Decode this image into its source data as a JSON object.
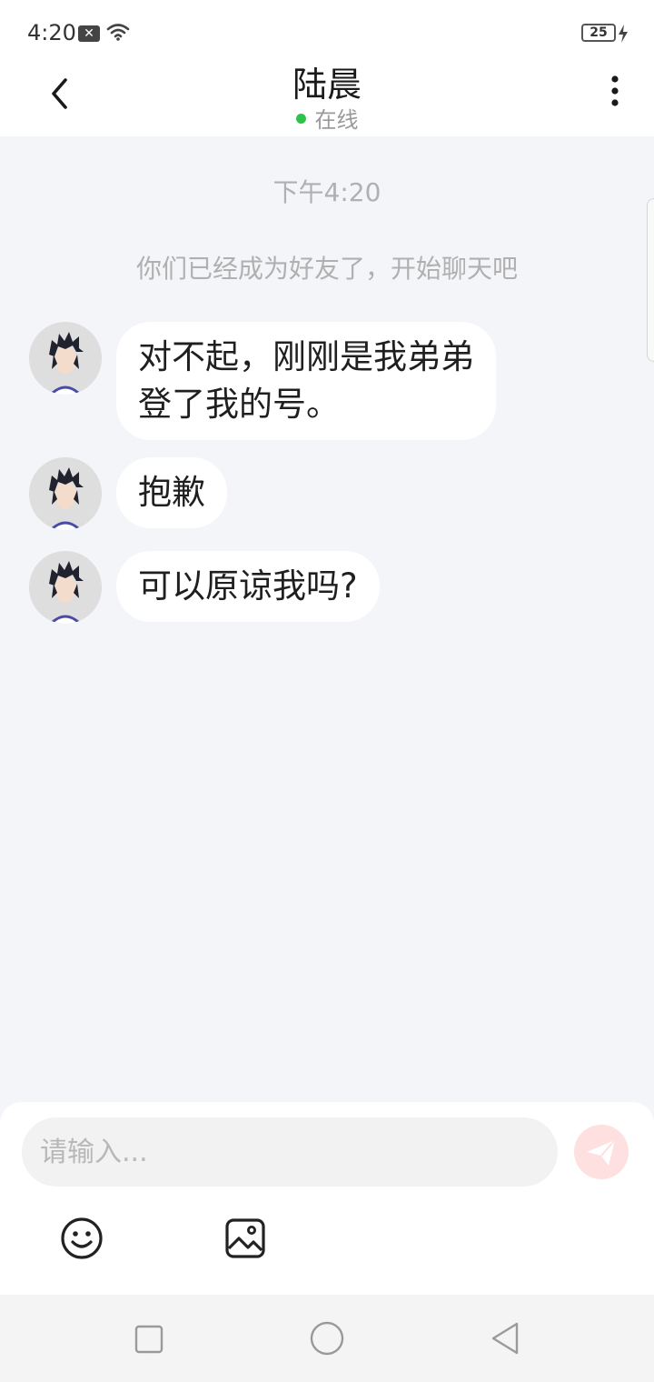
{
  "status_bar": {
    "time": "4:20",
    "battery": "25",
    "icons": [
      "notification-x-icon",
      "wifi-icon",
      "battery-icon",
      "charging-bolt-icon"
    ]
  },
  "header": {
    "contact_name": "陆晨",
    "status_text": "在线",
    "status_color": "#2ec24a",
    "icons": [
      "back-chevron-icon",
      "more-vertical-icon"
    ]
  },
  "chat": {
    "timestamp": "下午4:20",
    "system_tip": "你们已经成为好友了，开始聊天吧",
    "messages": [
      {
        "lines": [
          "对不起，刚刚是我弟弟",
          "登了我的号。"
        ]
      },
      {
        "lines": [
          "抱歉"
        ]
      },
      {
        "lines": [
          "可以原谅我吗?"
        ]
      }
    ]
  },
  "composer": {
    "placeholder": "请输入...",
    "value": "",
    "send_button_color": "#fde0df",
    "tool_icons": [
      "emoji-icon",
      "image-icon"
    ]
  },
  "nav": {
    "icons": [
      "recent-apps-icon",
      "home-icon",
      "back-triangle-icon"
    ]
  },
  "colors": {
    "background": "#f4f5f8",
    "bubble": "#ffffff",
    "muted_text": "#b0b0b0"
  }
}
